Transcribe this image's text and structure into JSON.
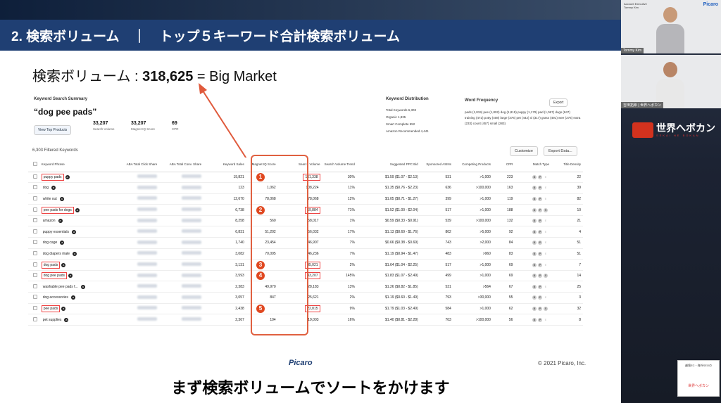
{
  "slide": {
    "header_title": "2. 検索ボリューム　｜　トップ５キーワード合計検索ボリューム",
    "big_line_prefix": "検索ボリューム : ",
    "big_line_number": "318,625",
    "big_line_suffix": " = Big Market",
    "copyright": "© 2021 Picaro, Inc.",
    "logo": "Picaro"
  },
  "summary": {
    "title": "Keyword Search Summary",
    "keyword": "“dog pee pads”",
    "view_button": "View Top Products",
    "stats": [
      {
        "value": "33,207",
        "label": "Search Volume"
      },
      {
        "value": "33,207",
        "label": "Magnet IQ Score"
      },
      {
        "value": "69",
        "label": "CPR"
      }
    ],
    "distribution_title": "Keyword Distribution",
    "distribution": [
      "Total Keywords 6,303",
      "Organic 1,835",
      "Smart Complete 552",
      "Amazon Recommended 4,441"
    ],
    "word_freq_title": "Word Frequency",
    "export_label": "Export",
    "word_freq_text": "pads (1,819) pee (1,802) dog (1,819) puppy (1,179) pad (1,067) dogs (847) training (472) potty (408) large (376) pet (442) xl (317) grass (491) wee (276) extra (233) count (457) small (283)"
  },
  "toolbar": {
    "filtered": "6,303 Filtered Keywords",
    "customize": "Customize",
    "export_data": "Export Data..."
  },
  "table": {
    "headers": [
      "",
      "Keyword Phrase",
      "ABA Total Click Share",
      "ABA Total Conv. Share",
      "Keyword Sales",
      "Magnet IQ Score",
      "Search Volume",
      "Search Volume Trend",
      "Suggested PPC Bid",
      "Sponsored ASINs",
      "Competing Products",
      "CPR",
      "Match Type",
      "Title Density"
    ],
    "rows": [
      {
        "kw": "puppy pads",
        "hl": true,
        "sales": "19,821",
        "iq": "",
        "vol": "161,338",
        "trend": "30%",
        "ppc": "$1.59 ($1.07 - $2.13)",
        "asins": "531",
        "comp": ">1,000",
        "cpr": "223",
        "title": "22"
      },
      {
        "kw": "dog",
        "hl": false,
        "sales": "123",
        "iq": "1,062",
        "vol": "108,224",
        "trend": "11%",
        "ppc": "$1.35 ($0.76 - $2.23)",
        "asins": "636",
        "comp": ">100,000",
        "cpr": "163",
        "title": "39"
      },
      {
        "kw": "white out",
        "hl": false,
        "sales": "12,670",
        "iq": "78,068",
        "vol": "78,068",
        "trend": "12%",
        "ppc": "$1.05 ($0.71 - $1.27)",
        "asins": "399",
        "comp": ">1,000",
        "cpr": "119",
        "title": "82"
      },
      {
        "kw": "pee pads for dogs",
        "hl": true,
        "sales": "6,738",
        "iq": "",
        "vol": "69,884",
        "trend": "71%",
        "ppc": "$1.52 ($1.00 - $2.04)",
        "asins": "517",
        "comp": ">1,000",
        "cpr": "188",
        "title": "10"
      },
      {
        "kw": "amazon",
        "hl": false,
        "sales": "8,258",
        "iq": "560",
        "vol": "58,017",
        "trend": "1%",
        "ppc": "$0.59 ($0.33 - $0.91)",
        "asins": "539",
        "comp": ">100,000",
        "cpr": "132",
        "title": "21"
      },
      {
        "kw": "puppy essentials",
        "hl": false,
        "sales": "6,831",
        "iq": "51,202",
        "vol": "56,032",
        "trend": "17%",
        "ppc": "$1.13 ($0.69 - $1.76)",
        "asins": "802",
        "comp": ">5,000",
        "cpr": "92",
        "title": "4"
      },
      {
        "kw": "dog cage",
        "hl": false,
        "sales": "1,740",
        "iq": "23,454",
        "vol": "46,907",
        "trend": "7%",
        "ppc": "$0.66 ($0.38 - $0.69)",
        "asins": "743",
        "comp": ">2,000",
        "cpr": "84",
        "title": "51"
      },
      {
        "kw": "dog diapers male",
        "hl": false,
        "sales": "3,082",
        "iq": "70,095",
        "vol": "46,236",
        "trend": "7%",
        "ppc": "$1.19 ($0.94 - $1.47)",
        "asins": "483",
        "comp": ">960",
        "cpr": "83",
        "title": "51"
      },
      {
        "kw": "dog pads",
        "hl": true,
        "sales": "3,131",
        "iq": "",
        "vol": "35,021",
        "trend": "2%",
        "ppc": "$1.64 ($1.04 - $2.25)",
        "asins": "517",
        "comp": ">1,000",
        "cpr": "69",
        "title": "7"
      },
      {
        "kw": "dog pee pads",
        "hl": true,
        "sales": "3,593",
        "iq": "",
        "vol": "33,207",
        "trend": "145%",
        "ppc": "$1.83 ($1.07 - $2.49)",
        "asins": "499",
        "comp": ">1,000",
        "cpr": "69",
        "title": "14"
      },
      {
        "kw": "washable pee pads f...",
        "hl": false,
        "sales": "2,383",
        "iq": "49,970",
        "vol": "28,183",
        "trend": "13%",
        "ppc": "$1.26 ($0.82 - $1.85)",
        "asins": "531",
        "comp": ">564",
        "cpr": "67",
        "title": "25"
      },
      {
        "kw": "dog accessories",
        "hl": false,
        "sales": "3,057",
        "iq": "847",
        "vol": "25,621",
        "trend": "2%",
        "ppc": "$1.19 ($0.60 - $1.49)",
        "asins": "793",
        "comp": ">30,000",
        "cpr": "55",
        "title": "3"
      },
      {
        "kw": "pee pads",
        "hl": true,
        "sales": "2,438",
        "iq": "",
        "vol": "22,815",
        "trend": "9%",
        "ppc": "$1.79 ($1.03 - $2.49)",
        "asins": "584",
        "comp": ">1,000",
        "cpr": "62",
        "title": "32"
      },
      {
        "kw": "pet supplies",
        "hl": false,
        "sales": "2,367",
        "iq": "194",
        "vol": "19,003",
        "trend": "16%",
        "ppc": "$1.40 ($0.81 - $2.28)",
        "asins": "703",
        "comp": ">100,000",
        "cpr": "56",
        "title": "8"
      }
    ]
  },
  "markers": [
    "1",
    "2",
    "3",
    "4",
    "5"
  ],
  "subtitle": "まず検索ボリュームでソートをかけます",
  "right_panel": {
    "cam1_logo": "Picaro",
    "cam1_name": "Tommy Kim",
    "cam1_label": "Account Executive",
    "cam2_name": "吉田拓希 | 世界へボカン",
    "brand": "世界へボカン",
    "brand_sub": "SEKAI HE BOKAN",
    "corner_text": "越境EC・海外SEOの",
    "corner_red": "世界へボカン"
  },
  "colors": {
    "header": "#1f3f73",
    "accent_red": "#e04820"
  }
}
